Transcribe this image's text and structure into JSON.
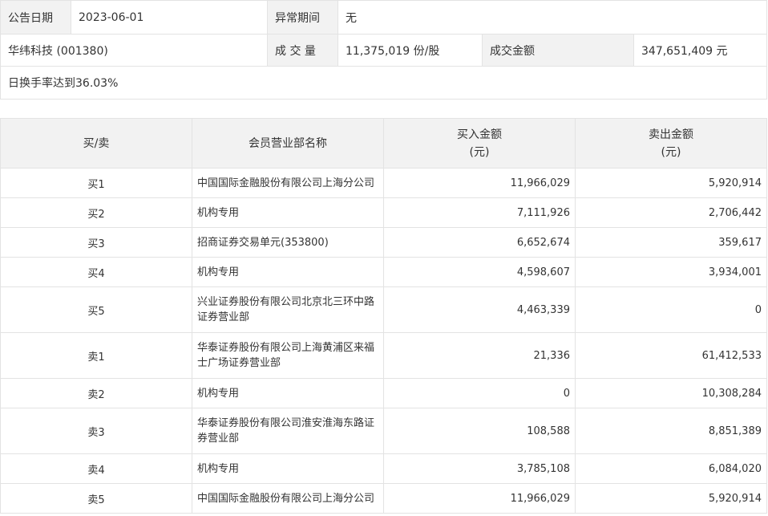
{
  "announcement": {
    "date_label": "公告日期",
    "date_value": "2023-06-01",
    "abnormal_period_label": "异常期间",
    "abnormal_period_value": "无",
    "stock_name": "华纬科技 (001380)",
    "volume_label": "成 交 量",
    "volume_value": "11,375,019 份/股",
    "turnover_label": "成交金额",
    "turnover_value": "347,651,409 元",
    "reason": "日换手率达到36.03%"
  },
  "table": {
    "headers": {
      "side": "买/卖",
      "member": "会员营业部名称",
      "buy_amount": "买入金额",
      "buy_unit": "(元)",
      "sell_amount": "卖出金额",
      "sell_unit": "(元)"
    },
    "rows": [
      {
        "side": "买1",
        "member": "中国国际金融股份有限公司上海分公司",
        "buy": "11,966,029",
        "sell": "5,920,914"
      },
      {
        "side": "买2",
        "member": "机构专用",
        "buy": "7,111,926",
        "sell": "2,706,442"
      },
      {
        "side": "买3",
        "member": "招商证券交易单元(353800)",
        "buy": "6,652,674",
        "sell": "359,617"
      },
      {
        "side": "买4",
        "member": "机构专用",
        "buy": "4,598,607",
        "sell": "3,934,001"
      },
      {
        "side": "买5",
        "member": "兴业证券股份有限公司北京北三环中路证券营业部",
        "buy": "4,463,339",
        "sell": "0"
      },
      {
        "side": "卖1",
        "member": "华泰证券股份有限公司上海黄浦区来福士广场证券营业部",
        "buy": "21,336",
        "sell": "61,412,533"
      },
      {
        "side": "卖2",
        "member": "机构专用",
        "buy": "0",
        "sell": "10,308,284"
      },
      {
        "side": "卖3",
        "member": "华泰证券股份有限公司淮安淮海东路证券营业部",
        "buy": "108,588",
        "sell": "8,851,389"
      },
      {
        "side": "卖4",
        "member": "机构专用",
        "buy": "3,785,108",
        "sell": "6,084,020"
      },
      {
        "side": "卖5",
        "member": "中国国际金融股份有限公司上海分公司",
        "buy": "11,966,029",
        "sell": "5,920,914"
      }
    ]
  }
}
